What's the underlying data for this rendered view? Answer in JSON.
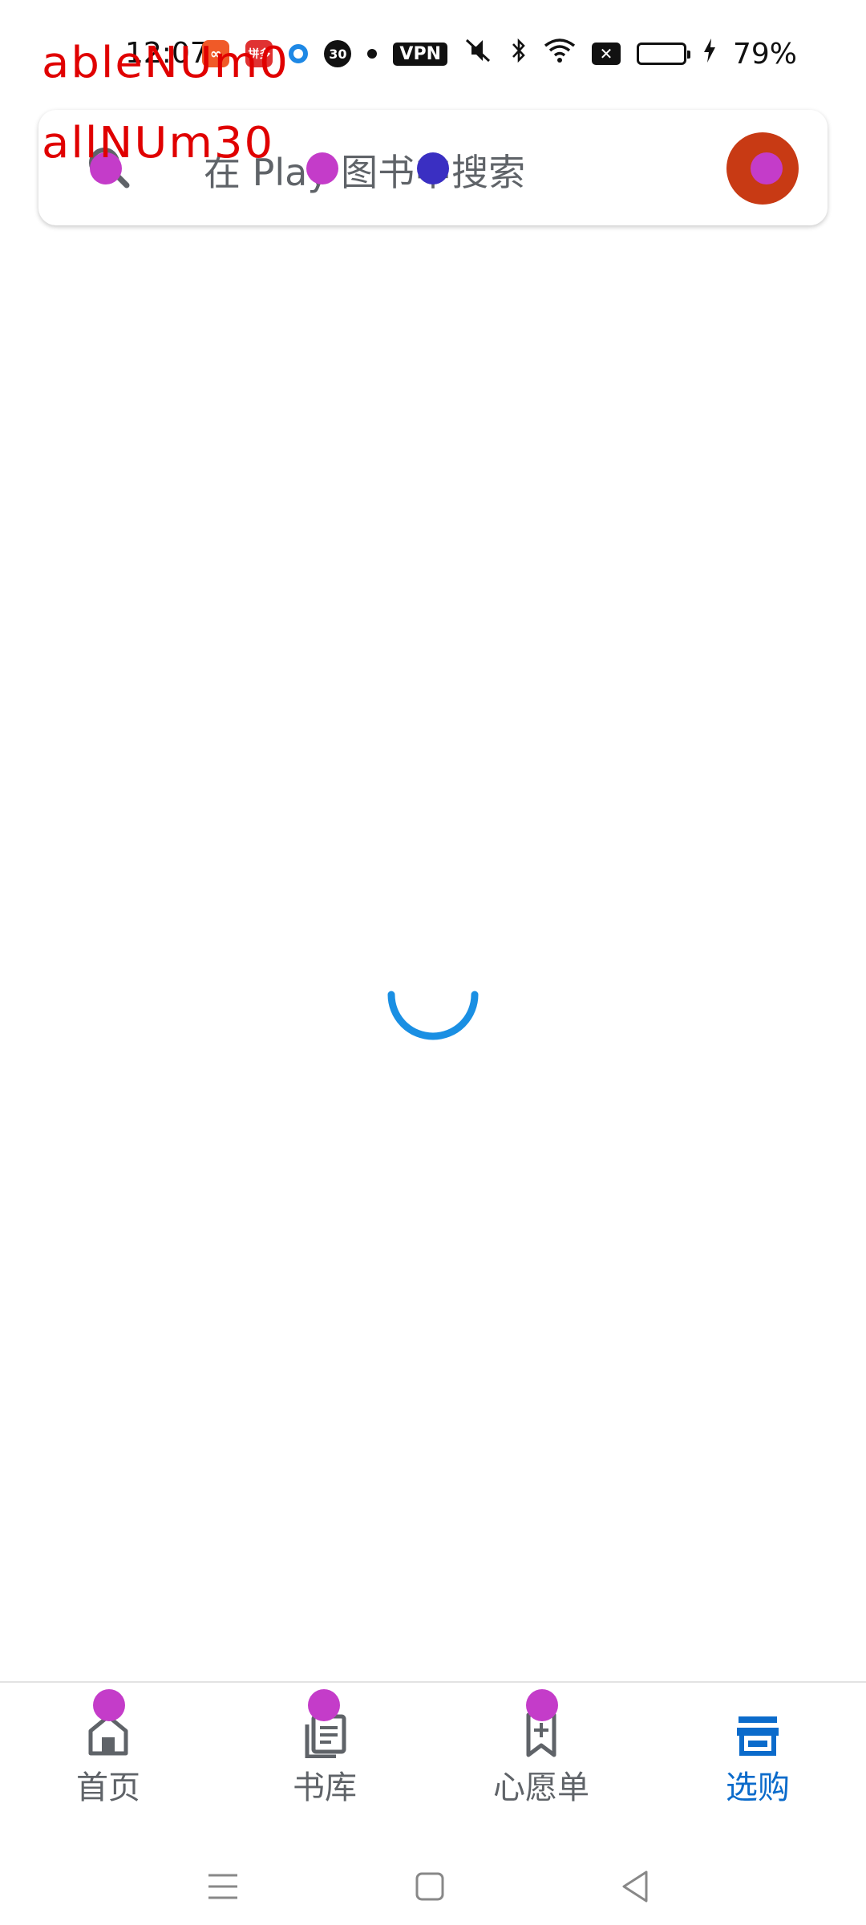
{
  "debug": {
    "line1": "ableNUm0",
    "line2": "allNUm30"
  },
  "status_bar": {
    "time": "12:07",
    "app_badge_1": "∞",
    "app_badge_2": "拼多",
    "circle_number": "30",
    "vpn": "VPN",
    "battery_percent": "79%",
    "battery_level": 0.79
  },
  "search": {
    "placeholder": "在 Play 图书中搜索"
  },
  "nav": {
    "items": [
      {
        "label": "首页",
        "icon": "home-icon",
        "active": false
      },
      {
        "label": "书库",
        "icon": "library-icon",
        "active": false
      },
      {
        "label": "心愿单",
        "icon": "wishlist-bookmark-icon",
        "active": false
      },
      {
        "label": "选购",
        "icon": "store-icon",
        "active": true
      }
    ]
  },
  "colors": {
    "accent": "#0b6bcb",
    "spinner": "#1a8fe3",
    "avatar": "#c83a14",
    "marker": "#c43cc9",
    "marker_blue": "#3a2fc2",
    "debug_text": "#e00000"
  }
}
